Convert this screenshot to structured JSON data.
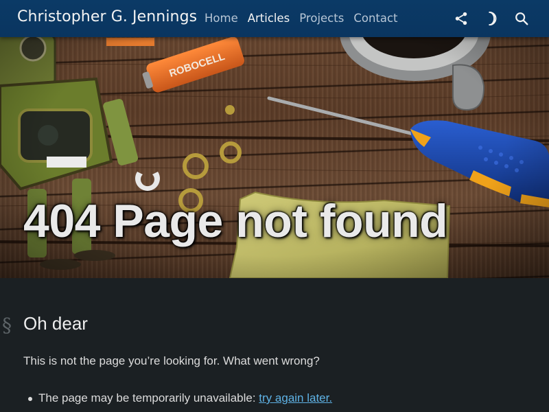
{
  "header": {
    "site_title": "Christopher G. Jennings",
    "nav": [
      {
        "label": "Home",
        "active": false
      },
      {
        "label": "Articles",
        "active": true
      },
      {
        "label": "Projects",
        "active": false
      },
      {
        "label": "Contact",
        "active": false
      }
    ],
    "tools": {
      "share_icon": "share-icon",
      "theme_icon": "moon-icon",
      "search_icon": "search-icon"
    }
  },
  "hero": {
    "title": "404 Page not found",
    "battery_label": "ROBOCELL"
  },
  "content": {
    "section_symbol": "§",
    "heading": "Oh dear",
    "intro": "This is not the page you’re looking for. What went wrong?",
    "reasons": [
      {
        "text": "The page may be temporarily unavailable: ",
        "link": "try again later."
      }
    ]
  },
  "colors": {
    "header_bg": "#0b3a66",
    "page_bg": "#1b2023",
    "link": "#5fb3e6",
    "text": "#dcdcdc"
  }
}
